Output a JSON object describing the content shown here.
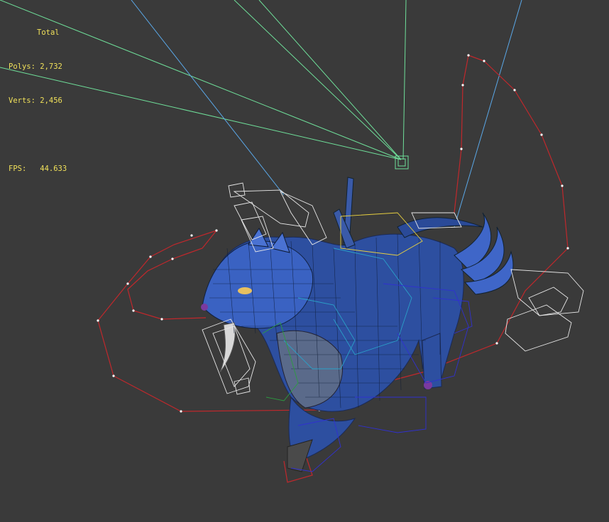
{
  "stats": {
    "header": "Total",
    "polys": "Polys: 2,732",
    "verts": "Verts: 2,456",
    "fps": "FPS:   44.633"
  },
  "colors": {
    "background": "#3a3a3a",
    "stats_text": "#f0e05a",
    "light_lines_green": "#6fe09a",
    "light_lines_blue": "#5aa8e8",
    "spline": "#c0282c",
    "bone_boxes": "#e8e8e8",
    "model_blue": "#2d4fa0"
  },
  "icons": [
    "light-gizmo-icon",
    "camera-spline-icon",
    "creature-model-icon"
  ]
}
